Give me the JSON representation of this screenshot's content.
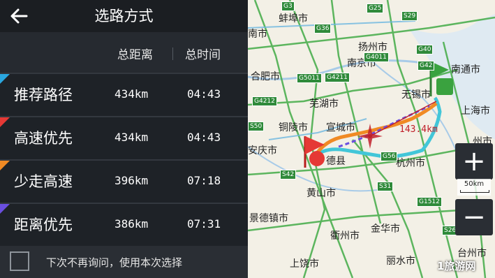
{
  "header": {
    "title": "选路方式"
  },
  "columns": {
    "distance": "总距离",
    "time": "总时间"
  },
  "routes": [
    {
      "name": "推荐路径",
      "distance": "434km",
      "time": "04:43",
      "color": "#2aa7e0"
    },
    {
      "name": "高速优先",
      "distance": "434km",
      "time": "04:43",
      "color": "#e53935"
    },
    {
      "name": "少走高速",
      "distance": "396km",
      "time": "07:18",
      "color": "#f08a24"
    },
    {
      "name": "距离优先",
      "distance": "386km",
      "time": "07:31",
      "color": "#6a4fe0"
    }
  ],
  "footer": {
    "checkbox_label": "下次不再询问，使用本次选择"
  },
  "map": {
    "cities": [
      "蚌埠市",
      "南京市",
      "扬州市",
      "南通市",
      "合肥市",
      "芜湖市",
      "无锡市",
      "上海市",
      "铜陵市",
      "宣城市",
      "安庆市",
      "德县",
      "杭州市",
      "黄山市",
      "景德镇市",
      "衢州市",
      "金华市",
      "上饶市",
      "丽水市",
      "台州市",
      "南市",
      "州市"
    ],
    "roads": [
      "G3",
      "G25",
      "S29",
      "G36",
      "G4011",
      "G40",
      "G42",
      "G4211",
      "G5011",
      "G4212",
      "S50",
      "G56",
      "S42",
      "S31",
      "G1512",
      "S26"
    ],
    "distance_label": "143.4km",
    "scale_label": "50km",
    "start_badge": "S",
    "end_badge": "G",
    "zoom_in": "+",
    "zoom_out": "−",
    "watermark": "1旅游网"
  }
}
